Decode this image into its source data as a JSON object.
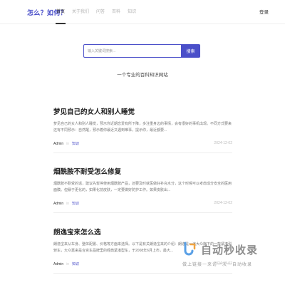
{
  "header": {
    "logo": "怎么？如何？",
    "nav": [
      "首页",
      "关于我们",
      "问答",
      "百科",
      "知识"
    ],
    "login": "登录"
  },
  "search": {
    "placeholder": "输入关键词搜索...",
    "button": "搜索",
    "tagline": "一个专业的百科知识网站"
  },
  "articles": [
    {
      "title": "梦见自己的女人和别人睡觉",
      "excerpt": "梦见自己的女人和别人睡觉，预示你近期恋爱有所下降，多注重身边的事情，会有很好的事机出现。不同方式要来还有不同预示：自然醒，预示着你最近又遇到难事，提示你，最近都要...",
      "author": "Admin",
      "category": "知识",
      "date": "2024-12-02"
    },
    {
      "title": "烟酰胺不耐受怎么修复",
      "excerpt": "烟酰胺不耐受的话，建议先暂停使用烟酰胺产品，还要及时就医做好补充水分，这个时候可以考虑成分安全的医用面膜。但暴于更化的，如果化前皮肤，一定要做好防护工作。如果皮肤出...",
      "author": "Admin",
      "category": "知识",
      "date": "2024-12-02"
    },
    {
      "title": "朗逸宝来怎么选",
      "excerpt": "朗逸宝来从车身、整体配置、价格等方面来选择。以下是有关朗逸宝来的介绍：朗逸是一汽大众旗下的一款紧凑型轿车，大众嘉来是合资车品牌里的经典紧凑型车，于2008年6月上市，最大...",
      "author": "Admin",
      "category": "知识",
      "date": "2024-12-02"
    }
  ],
  "watermark": {
    "brand": "自动秒收录",
    "slogan": "做上链接一来访一次一自动收录"
  }
}
